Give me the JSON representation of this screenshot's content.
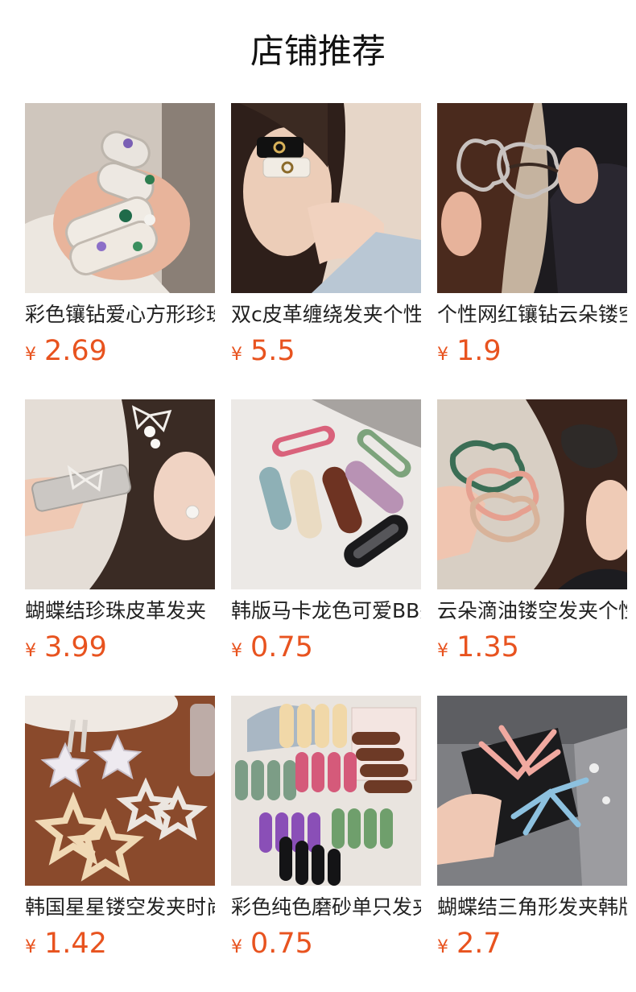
{
  "section": {
    "title": "店铺推荐"
  },
  "currency_symbol": "¥",
  "colors": {
    "price": "#e8531f",
    "title": "#111111"
  },
  "products": [
    {
      "name": "彩色镶钻爱心方形珍珠发夹",
      "price": "2.69",
      "image_icon": "product-photo-gem-hair-clips"
    },
    {
      "name": "双c皮革缠绕发夹个性",
      "price": "5.5",
      "image_icon": "product-photo-leather-hair-clip"
    },
    {
      "name": "个性网红镶钻云朵镂空发夹",
      "price": "1.9",
      "image_icon": "product-photo-rhinestone-cloud-clip"
    },
    {
      "name": "蝴蝶结珍珠皮革发夹",
      "price": "3.99",
      "image_icon": "product-photo-bow-pearl-clip"
    },
    {
      "name": "韩版马卡龙色可爱BB夹",
      "price": "0.75",
      "image_icon": "product-photo-macaron-bb-clips"
    },
    {
      "name": "云朵滴油镂空发夹个性",
      "price": "1.35",
      "image_icon": "product-photo-cloud-enamel-clip"
    },
    {
      "name": "韩国星星镂空发夹时尚",
      "price": "1.42",
      "image_icon": "product-photo-star-clips"
    },
    {
      "name": "彩色纯色磨砂单只发夹",
      "price": "0.75",
      "image_icon": "product-photo-matte-color-clips"
    },
    {
      "name": "蝴蝶结三角形发夹韩版",
      "price": "2.7",
      "image_icon": "product-photo-triangle-bow-clips"
    }
  ]
}
